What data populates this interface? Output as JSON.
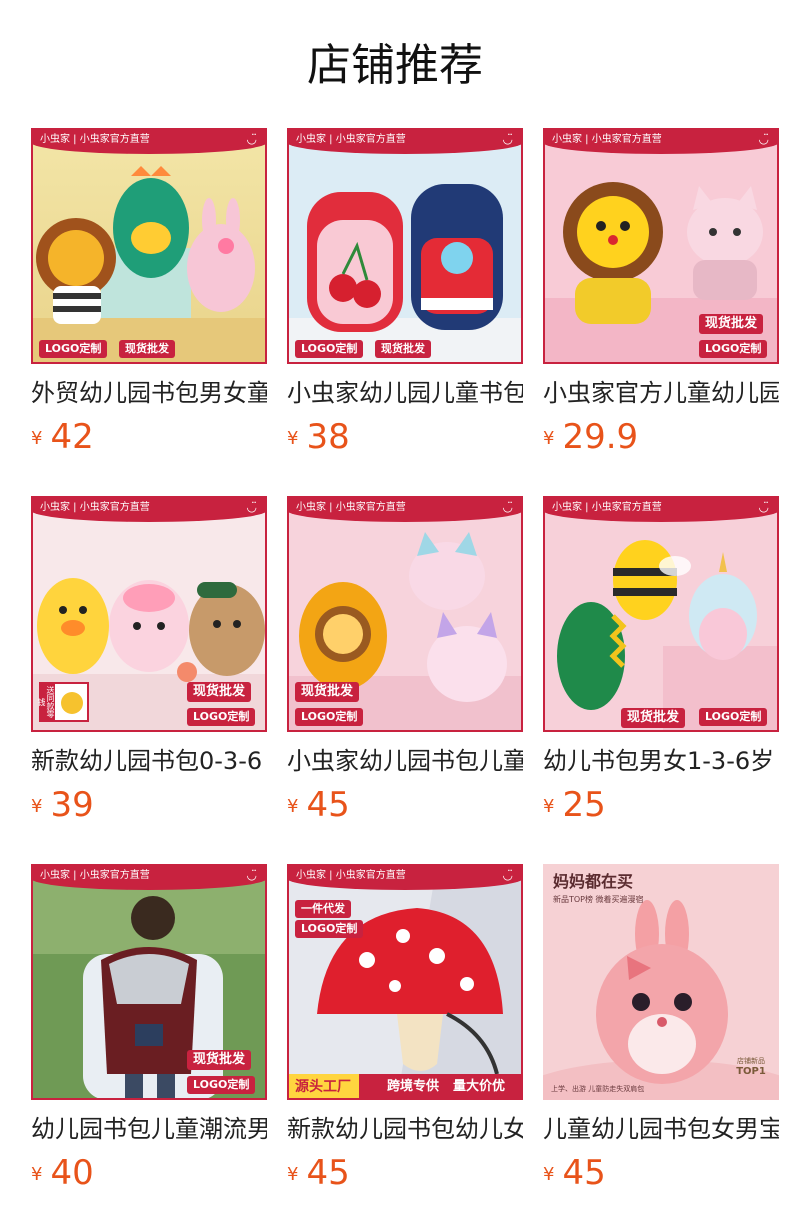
{
  "page": {
    "title": "店铺推荐"
  },
  "colors": {
    "accent": "#c8223f",
    "price": "#e8531a"
  },
  "products": [
    {
      "name": "外贸幼儿园书包男女童",
      "currency": "¥",
      "price": "42",
      "brand": "小虫家 | 小虫家官方直营",
      "tags": [
        "LOGO定制",
        "现货批发"
      ],
      "icon": "smile-icon"
    },
    {
      "name": "小虫家幼儿园儿童书包",
      "currency": "¥",
      "price": "38",
      "brand": "小虫家 | 小虫家官方直营",
      "tags": [
        "LOGO定制",
        "现货批发"
      ],
      "icon": "smile-icon"
    },
    {
      "name": "小虫家官方儿童幼儿园",
      "currency": "¥",
      "price": "29.9",
      "brand": "小虫家 | 小虫家官方直营",
      "tags": [
        "现货批发",
        "LOGO定制"
      ],
      "icon": "smile-icon"
    },
    {
      "name": "新款幼儿园书包0-3-6",
      "currency": "¥",
      "price": "39",
      "brand": "小虫家 | 小虫家官方直营",
      "tags": [
        "现货批发",
        "LOGO定制"
      ],
      "extra": "送同款零钱",
      "icon": "smile-icon"
    },
    {
      "name": "小虫家幼儿园书包儿童",
      "currency": "¥",
      "price": "45",
      "brand": "小虫家 | 小虫家官方直营",
      "tags": [
        "现货批发",
        "LOGO定制"
      ],
      "icon": "smile-icon"
    },
    {
      "name": "幼儿书包男女1-3-6岁",
      "currency": "¥",
      "price": "25",
      "brand": "小虫家 | 小虫家官方直营",
      "tags": [
        "现货批发",
        "LOGO定制"
      ],
      "icon": "smile-icon"
    },
    {
      "name": "幼儿园书包儿童潮流男",
      "currency": "¥",
      "price": "40",
      "brand": "小虫家 | 小虫家官方直营",
      "tags": [
        "现货批发",
        "LOGO定制"
      ],
      "icon": "smile-icon"
    },
    {
      "name": "新款幼儿园书包幼儿女",
      "currency": "¥",
      "price": "45",
      "brand": "小虫家 | 小虫家官方直营",
      "tags": [
        "一件代发",
        "LOGO定制"
      ],
      "banner": [
        "源头工厂",
        "跨境专供",
        "量大价优"
      ],
      "icon": "smile-icon"
    },
    {
      "name": "儿童幼儿园书包女男宝",
      "currency": "¥",
      "price": "45",
      "headline": "妈妈都在买",
      "subline": "新品TOP榜 微着买遍漫宿",
      "bottom_note": "上学、出游 儿童防走失双肩包",
      "badge": [
        "店铺新品",
        "TOP1"
      ]
    }
  ]
}
